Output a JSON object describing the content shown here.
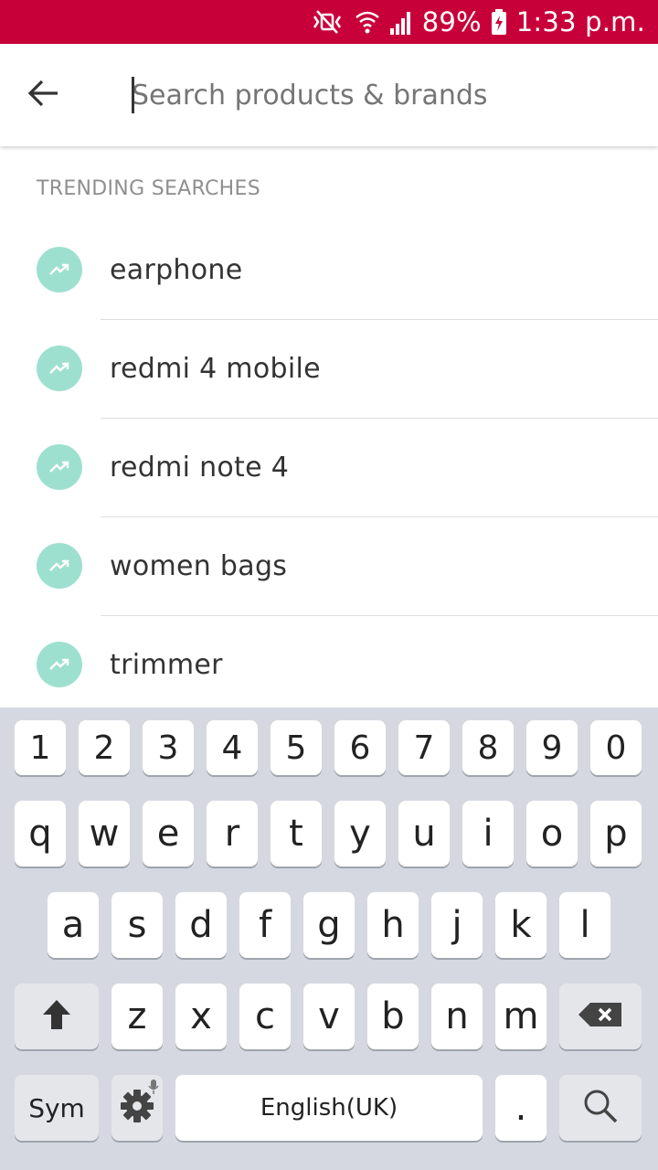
{
  "status_bar": {
    "battery": "89%",
    "time": "1:33 p.m.",
    "icons": [
      "mute-icon",
      "wifi-icon",
      "signal-icon",
      "battery-charging-icon"
    ],
    "color": "#c8003a"
  },
  "search": {
    "placeholder": "Search products & brands",
    "value": ""
  },
  "trending": {
    "title": "TRENDING SEARCHES",
    "icon": "trending-up-icon",
    "icon_color": "#9ee0d0",
    "items": [
      {
        "label": "earphone"
      },
      {
        "label": "redmi 4 mobile"
      },
      {
        "label": "redmi note 4"
      },
      {
        "label": "women bags"
      },
      {
        "label": "trimmer"
      }
    ]
  },
  "keyboard": {
    "row_numbers": [
      "1",
      "2",
      "3",
      "4",
      "5",
      "6",
      "7",
      "8",
      "9",
      "0"
    ],
    "row_1": [
      "q",
      "w",
      "e",
      "r",
      "t",
      "y",
      "u",
      "i",
      "o",
      "p"
    ],
    "row_2": [
      "a",
      "s",
      "d",
      "f",
      "g",
      "h",
      "j",
      "k",
      "l"
    ],
    "row_3": [
      "z",
      "x",
      "c",
      "v",
      "b",
      "n",
      "m"
    ],
    "sym_label": "Sym",
    "space_label": "English(UK)",
    "period_label": ".",
    "icons": [
      "shift-icon",
      "backspace-icon",
      "settings-icon",
      "microphone-icon",
      "search-key-icon"
    ]
  }
}
